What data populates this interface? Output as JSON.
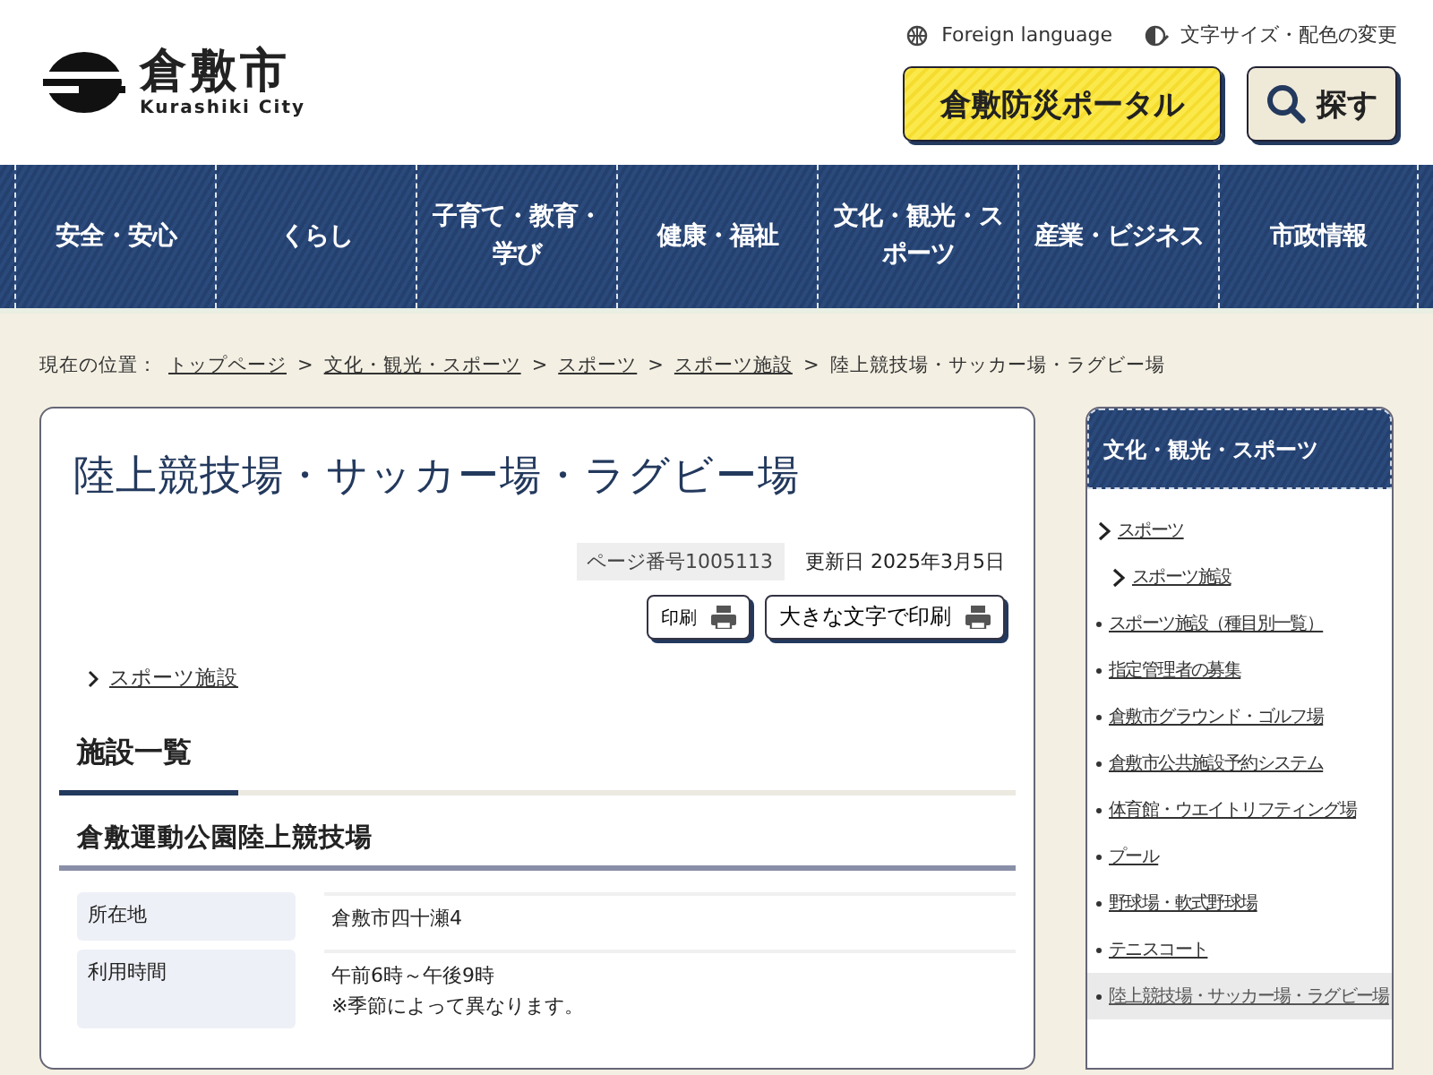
{
  "header": {
    "logo_name": "倉敷市",
    "logo_sub": "Kurashiki City",
    "utility_links": [
      "Foreign language",
      "文字サイズ・配色の変更"
    ],
    "disaster_button": "倉敷防災ポータル",
    "search_button": "探す"
  },
  "nav": [
    "安全・安心",
    "くらし",
    "子育て・教育・学び",
    "健康・福祉",
    "文化・観光・スポーツ",
    "産業・ビジネス",
    "市政情報"
  ],
  "breadcrumb": {
    "label": "現在の位置：",
    "links": [
      "トップページ",
      "文化・観光・スポーツ",
      "スポーツ",
      "スポーツ施設"
    ],
    "separator": ">",
    "current": "陸上競技場・サッカー場・ラグビー場"
  },
  "page": {
    "title": "陸上競技場・サッカー場・ラグビー場",
    "page_number": "ページ番号1005113",
    "updated": "更新日 2025年3月5日",
    "print_buttons": [
      "印刷",
      "大きな文字で印刷"
    ],
    "parent_link": "スポーツ施設",
    "section_heading": "施設一覧",
    "facilities": [
      {
        "name": "倉敷運動公園陸上競技場",
        "details": [
          {
            "label": "所在地",
            "lines": [
              "倉敷市四十瀬4"
            ]
          },
          {
            "label": "利用時間",
            "lines": [
              "午前6時～午後9時",
              "※季節によって異なります。"
            ]
          }
        ]
      }
    ]
  },
  "sidebar": {
    "title": "文化・観光・スポーツ",
    "items": [
      {
        "label": "スポーツ",
        "selected": false,
        "children": [
          {
            "label": "スポーツ施設",
            "selected": false,
            "children": [
              {
                "label": "スポーツ施設（種目別一覧）",
                "selected": false
              },
              {
                "label": "指定管理者の募集",
                "selected": false
              },
              {
                "label": "倉敷市グラウンド・ゴルフ場",
                "selected": false
              },
              {
                "label": "倉敷市公共施設予約システム",
                "selected": false
              },
              {
                "label": "体育館・ウエイトリフティング場",
                "selected": false
              },
              {
                "label": "プール",
                "selected": false
              },
              {
                "label": "野球場・軟式野球場",
                "selected": false
              },
              {
                "label": "テニスコート",
                "selected": false
              },
              {
                "label": "陸上競技場・サッカー場・ラグビー場",
                "selected": true
              }
            ]
          }
        ]
      }
    ]
  }
}
